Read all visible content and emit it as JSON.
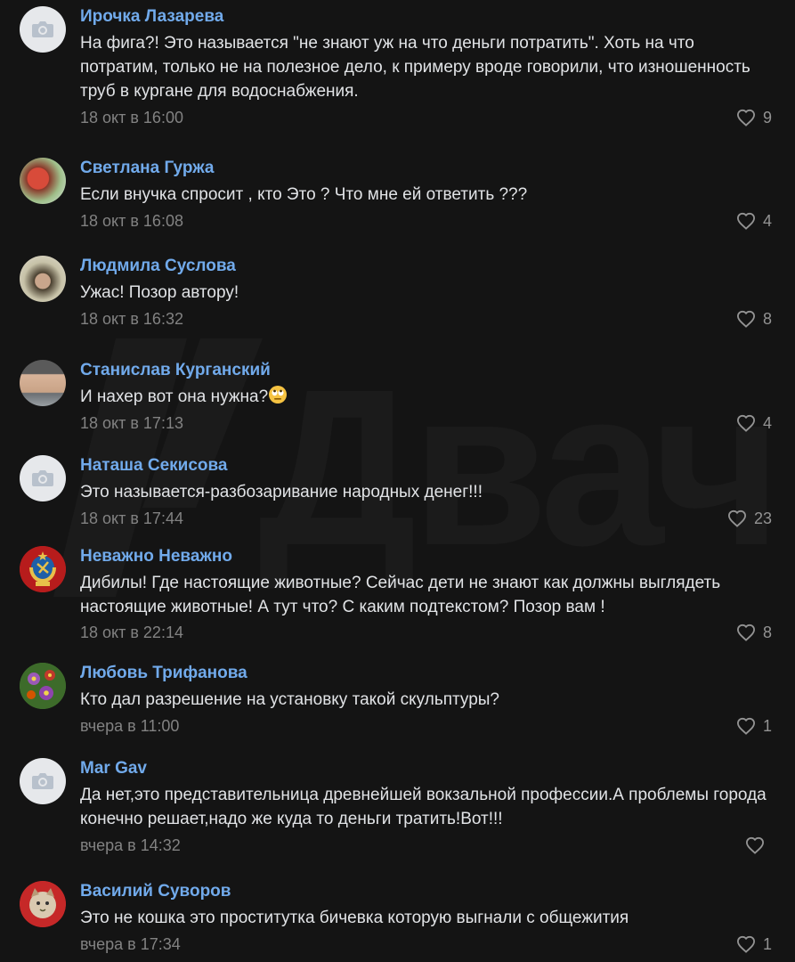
{
  "watermark": {
    "text": "Двач"
  },
  "comments": [
    {
      "author": "Ирочка Лазарева",
      "text": "На фига?! Это называется \"не знают уж на что деньги потратить\". Хоть на что потратим, только не на полезное дело, к примеру вроде говорили, что изношенность труб в кургане для водоснабжения.",
      "time": "18 окт в 16:00",
      "likes": "9",
      "avatar": "camera-placeholder"
    },
    {
      "author": "Светлана Гуржа",
      "text": "Если внучка спросит , кто Это ? Что мне ей ответить ???",
      "time": "18 окт в 16:08",
      "likes": "4",
      "avatar": "photo"
    },
    {
      "author": "Людмила Суслова",
      "text": "Ужас! Позор автору!",
      "time": "18 окт в 16:32",
      "likes": "8",
      "avatar": "photo"
    },
    {
      "author": "Станислав Курганский",
      "text": "И нахер вот она нужна?",
      "time": "18 окт в 17:13",
      "likes": "4",
      "avatar": "photo",
      "emoji": "eye-roll-emoji"
    },
    {
      "author": "Наташа Секисова",
      "text": "Это называется-разбозаривание народных денег!!!",
      "time": "18 окт в 17:44",
      "likes": "23",
      "avatar": "camera-placeholder"
    },
    {
      "author": "Неважно Неважно",
      "text": "Дибилы! Где настоящие животные? Сейчас дети не знают как должны выглядеть настоящие животные! А тут что? С каким подтекстом? Позор вам !",
      "time": "18 окт в 22:14",
      "likes": "8",
      "avatar": "ussr-emblem"
    },
    {
      "author": "Любовь Трифанова",
      "text": "Кто дал разрешение на установку такой скульптуры?",
      "time": "вчера в 11:00",
      "likes": "1",
      "avatar": "flowers"
    },
    {
      "author": "Mar Gav",
      "text": "Да нет,это представительница древнейшей вокзальной профессии.А проблемы города конечно решает,надо же куда то деньги тратить!Вот!!!",
      "time": "вчера в 14:32",
      "likes": "",
      "avatar": "camera-placeholder"
    },
    {
      "author": "Василий Суворов",
      "text": "Это не кошка это проститутка бичевка которую выгнали с общежития",
      "time": "вчера в 17:34",
      "likes": "1",
      "avatar": "cat"
    }
  ],
  "colors": {
    "background": "#141414",
    "author": "#71aaeb",
    "text": "#e1e3e6",
    "meta": "#828282"
  }
}
